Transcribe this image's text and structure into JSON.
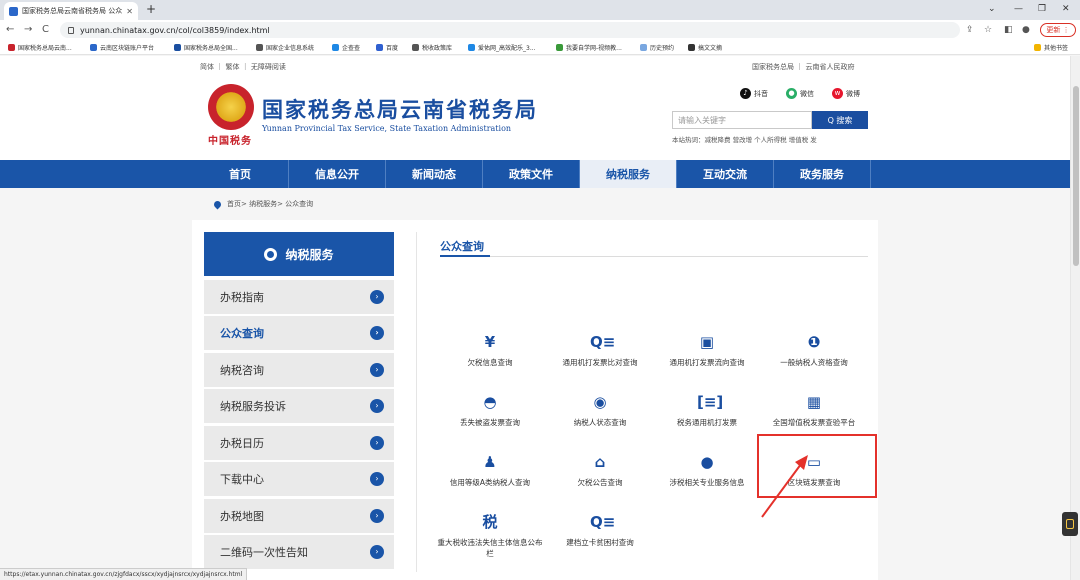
{
  "browser": {
    "tab_title": "国家税务总局云南省税务局 公众...",
    "url": "yunnan.chinatax.gov.cn/col/col3859/index.html",
    "update_label": "更新",
    "bookmarks": [
      "国家税务总局云南...",
      "云南区块链账户平台",
      "国家税务总局全国...",
      "国家企业信息系统",
      "企查查",
      "百度",
      "税收政策库",
      "爱佑网_高效配乐_3...",
      "我要自学网-视频教...",
      "历史预约",
      "搞文文摘"
    ],
    "other_bookmarks": "其他书签",
    "status_url": "https://etax.yunnan.chinatax.gov.cn/zjgfdacx/sscx/xydjajnsrcx/xydjajnsrcx.html"
  },
  "topstrip": {
    "left": "简体 ｜ 繁体 ｜ 无障碍阅读",
    "right": "国家税务总局 ｜ 云南省人民政府"
  },
  "header": {
    "emblem_text": "中国税务",
    "title": "国家税务总局云南省税务局",
    "subtitle": "Yunnan Provincial Tax Service, State Taxation Administration",
    "social": [
      "抖音",
      "微信",
      "微博"
    ],
    "search_placeholder": "请输入关键字",
    "search_button": "Q 搜索",
    "hotwords": "本站热词：减税降费  营改增  个人所得税  增值税  发"
  },
  "nav": [
    "首页",
    "信息公开",
    "新闻动态",
    "政策文件",
    "纳税服务",
    "互动交流",
    "政务服务"
  ],
  "breadcrumb": "首页> 纳税服务> 公众查询",
  "sidebar": {
    "title": "纳税服务",
    "items": [
      "办税指南",
      "公众查询",
      "纳税咨询",
      "纳税服务投诉",
      "办税日历",
      "下载中心",
      "办税地图",
      "二维码一次性告知"
    ]
  },
  "section_title": "公众查询",
  "services": [
    "欠税信息查询",
    "通用机打发票比对查询",
    "通用机打发票流向查询",
    "一般纳税人资格查询",
    "丢失被盗发票查询",
    "纳税人状态查询",
    "税务通用机打发票",
    "全国增值税发票查验平台",
    "信用等级A类纳税人查询",
    "欠税公告查询",
    "涉税相关专业服务信息",
    "区块链发票查询",
    "重大税收违法失信主体信息公布栏",
    "建档立卡贫困村查询"
  ],
  "service_icons": [
    "yen-icon",
    "search-list-icon",
    "ticket-icon",
    "person-info-icon",
    "cap-icon",
    "person-search-icon",
    "bracket-list-icon",
    "grid-chip-icon",
    "person-doc-icon",
    "building-icon",
    "person-icon",
    "monitor-icon",
    "tax-stamp-icon",
    "search-list-icon"
  ],
  "colors": {
    "brand_blue": "#1a55a8",
    "highlight_red": "#e4312b"
  }
}
